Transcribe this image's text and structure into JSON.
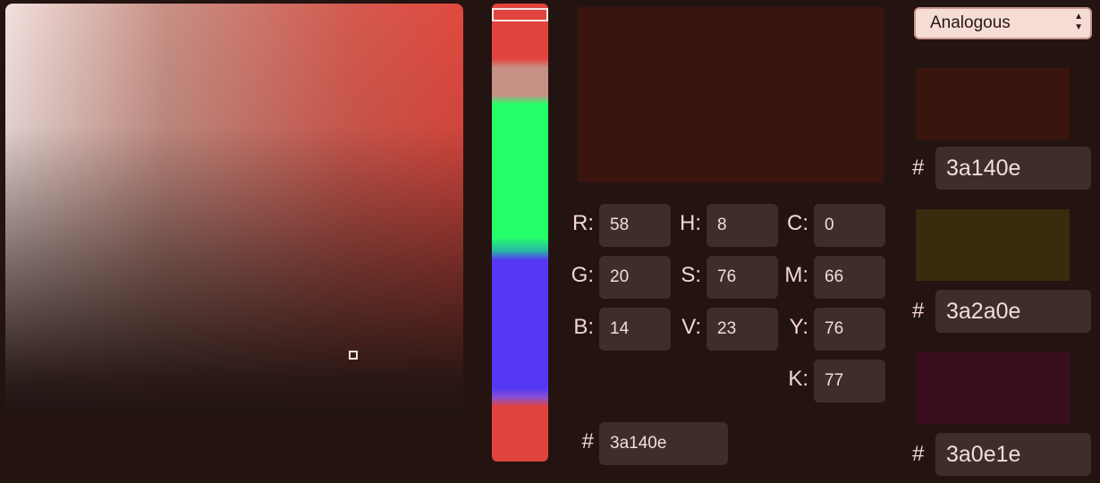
{
  "picker": {
    "fields": {
      "r": {
        "label": "R:",
        "value": "58"
      },
      "g": {
        "label": "G:",
        "value": "20"
      },
      "b": {
        "label": "B:",
        "value": "14"
      },
      "h": {
        "label": "H:",
        "value": "8"
      },
      "s": {
        "label": "S:",
        "value": "76"
      },
      "v": {
        "label": "V:",
        "value": "23"
      },
      "c": {
        "label": "C:",
        "value": "0"
      },
      "m": {
        "label": "M:",
        "value": "66"
      },
      "y": {
        "label": "Y:",
        "value": "76"
      },
      "k": {
        "label": "K:",
        "value": "77"
      }
    },
    "hex_symbol": "#",
    "hex_value": "3a140e",
    "preview_color": "#3a140e"
  },
  "scheme": {
    "selected": "Analogous",
    "arrows_icon": "up-down-arrows-icon",
    "colors": [
      {
        "hash": "#",
        "hex": "3a140e",
        "color": "#3a140e"
      },
      {
        "hash": "#",
        "hex": "3a2a0e",
        "color": "#3a2a0e"
      },
      {
        "hash": "#",
        "hex": "3a0e1e",
        "color": "#3a0e1e"
      }
    ]
  },
  "colors": {
    "background": "#231412",
    "field_bg": "#3d2e2c",
    "accent_red": "#e1443e"
  }
}
